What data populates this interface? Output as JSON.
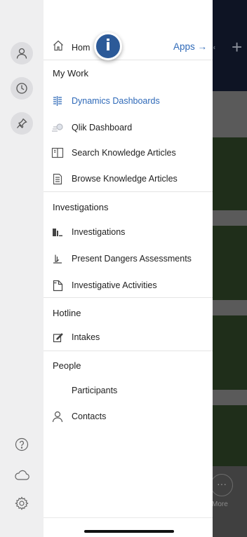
{
  "background": {
    "more_label": "More",
    "more_glyph": "···",
    "plus_glyph": "+"
  },
  "rail": {
    "icons": [
      "user-icon",
      "recent-clock-icon",
      "pin-icon",
      "help-icon",
      "cloud-icon",
      "settings-gear-icon"
    ]
  },
  "drawer": {
    "home": {
      "label": "Hom",
      "icon": "home-icon"
    },
    "info_badge": "i",
    "apps_link": "Apps →",
    "sections": {
      "my_work": {
        "title": "My Work",
        "items": [
          {
            "label": "Dynamics Dashboards",
            "icon": "dashboard-grid-icon",
            "selected": true
          },
          {
            "label": "Qlik Dashboard",
            "icon": "qlik-icon"
          },
          {
            "label": "Search Knowledge Articles",
            "icon": "book-open-icon"
          },
          {
            "label": "Browse Knowledge Articles",
            "icon": "document-list-icon"
          }
        ]
      },
      "investigations": {
        "title": "Investigations",
        "items": [
          {
            "label": "Investigations",
            "icon": "investigation-icon"
          },
          {
            "label": "Present Dangers Assessments",
            "icon": "danger-assessment-icon"
          },
          {
            "label": "Investigative Activities",
            "icon": "activity-document-icon"
          }
        ]
      },
      "hotline": {
        "title": "Hotline",
        "items": [
          {
            "label": "Intakes",
            "icon": "edit-note-icon"
          }
        ]
      },
      "people": {
        "title": "People",
        "items": [
          {
            "label": "Participants",
            "icon": ""
          },
          {
            "label": "Contacts",
            "icon": "person-icon"
          }
        ]
      }
    }
  },
  "colors": {
    "accent": "#2e69b8",
    "info_badge": "#2c5a98",
    "rail_bg": "#efeff0",
    "drawer_bg": "#ffffff"
  }
}
